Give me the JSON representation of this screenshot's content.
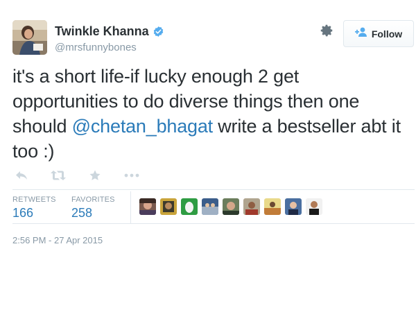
{
  "user": {
    "name": "Twinkle Khanna",
    "handle": "@mrsfunnybones",
    "verified": true
  },
  "follow_button": {
    "label": "Follow"
  },
  "tweet": {
    "text_before": "it's a short life-if lucky enough 2 get opportunities to do diverse things then one should ",
    "mention": "@chetan_bhagat",
    "text_after": " write a bestseller abt it too :)"
  },
  "actions": [
    "reply-icon",
    "retweet-icon",
    "favorite-icon",
    "more-icon"
  ],
  "stats": {
    "retweets_label": "RETWEETS",
    "retweets_count": "166",
    "favorites_label": "FAVORITES",
    "favorites_count": "258"
  },
  "timestamp": "2:56 PM - 27 Apr 2015",
  "colors": {
    "link": "#2b7bb9",
    "muted": "#8899a6",
    "text": "#292f33",
    "verified": "#55acee"
  }
}
